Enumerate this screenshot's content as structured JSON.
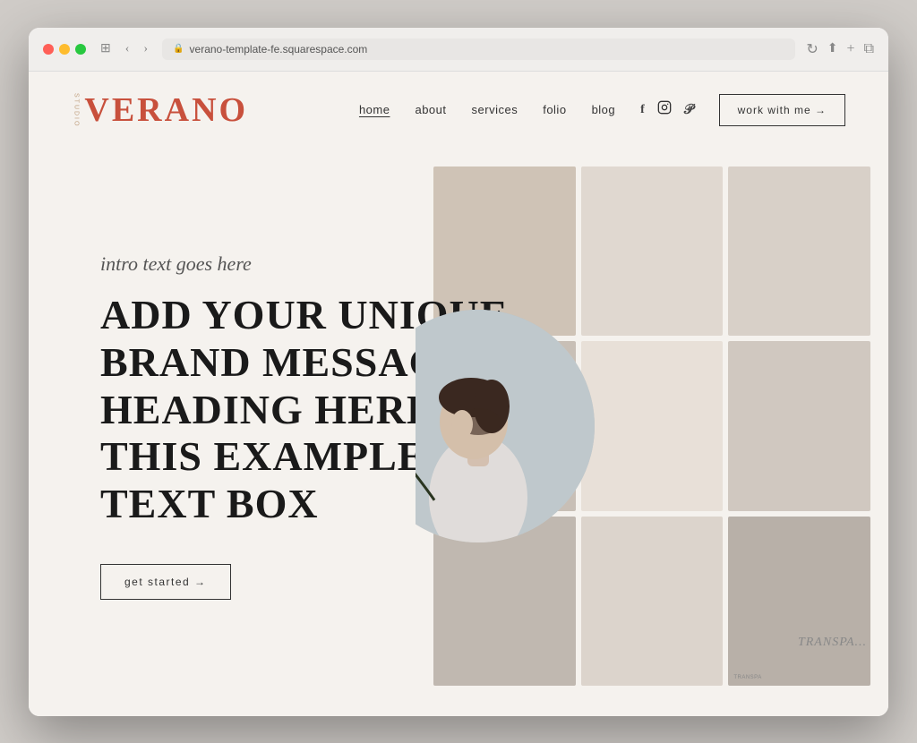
{
  "browser": {
    "url": "verano-template-fe.squarespace.com",
    "back_label": "‹",
    "forward_label": "›",
    "refresh_label": "↻",
    "share_label": "⎋",
    "new_tab_label": "+",
    "duplicate_label": "⧉",
    "window_icon": "⊞"
  },
  "logo": {
    "side_text": "STUDIO",
    "main_text": "VERANO"
  },
  "nav": {
    "links": [
      {
        "label": "home",
        "active": true
      },
      {
        "label": "about",
        "active": false
      },
      {
        "label": "services",
        "active": false
      },
      {
        "label": "folio",
        "active": false
      },
      {
        "label": "blog",
        "active": false
      }
    ],
    "social": [
      {
        "name": "facebook",
        "icon": "f"
      },
      {
        "name": "instagram",
        "icon": "◻"
      },
      {
        "name": "pinterest",
        "icon": "𝒫"
      }
    ],
    "cta_label": "work with me →"
  },
  "hero": {
    "intro_text": "intro text goes here",
    "heading": "ADD YOUR UNIQUE BRAND MESSAGE HEADING HERE IN THIS EXAMPLE TEXT BOX",
    "cta_label": "get started →"
  },
  "mood_cards": [
    {
      "label": ""
    },
    {
      "label": ""
    },
    {
      "label": ""
    },
    {
      "label": ""
    },
    {
      "label": ""
    },
    {
      "label": ""
    },
    {
      "label": ""
    },
    {
      "label": ""
    },
    {
      "label": "TRANSPA"
    }
  ],
  "colors": {
    "logo_red": "#c8503c",
    "background": "#f5f2ee",
    "text_dark": "#1a1a1a",
    "border": "#333333"
  }
}
